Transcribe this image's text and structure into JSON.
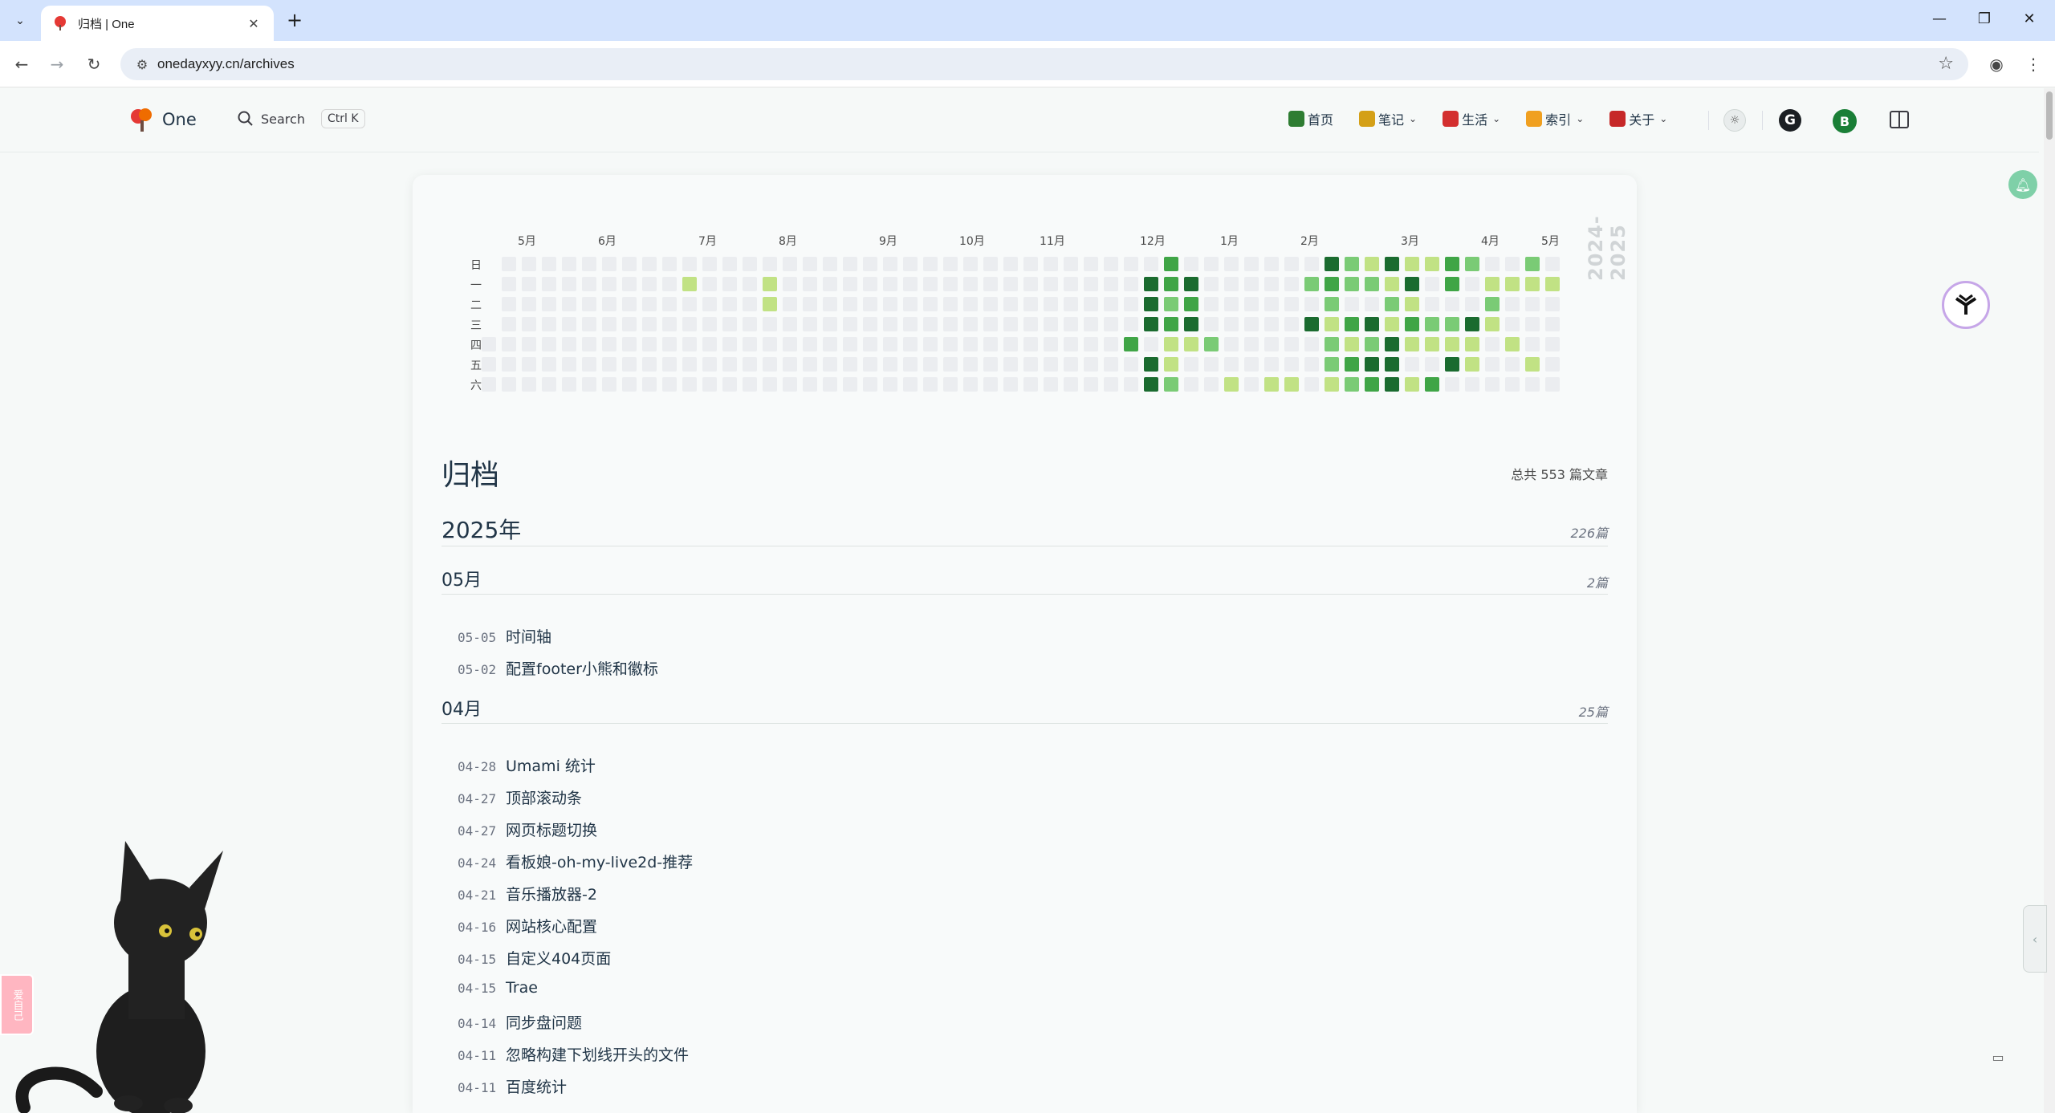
{
  "browser": {
    "tab_title": "归档 | One",
    "url": "onedayxyy.cn/archives",
    "new_tab_symbol": "+",
    "close_symbol": "✕"
  },
  "header": {
    "logo_text": "One",
    "search_label": "Search",
    "search_shortcut": "Ctrl K",
    "nav": [
      {
        "label": "首页",
        "color": "#2e7d32",
        "has_dropdown": false
      },
      {
        "label": "笔记",
        "color": "#d4a017",
        "has_dropdown": true
      },
      {
        "label": "生活",
        "color": "#d32f2f",
        "has_dropdown": true
      },
      {
        "label": "索引",
        "color": "#f0a020",
        "has_dropdown": true
      },
      {
        "label": "关于",
        "color": "#c62828",
        "has_dropdown": true
      }
    ],
    "github_glyph": "G",
    "avatar_letter": "B"
  },
  "heatmap": {
    "months": [
      "5月",
      "6月",
      "7月",
      "8月",
      "9月",
      "10月",
      "11月",
      "12月",
      "1月",
      "2月",
      "3月",
      "4月",
      "5月"
    ],
    "weekdays": [
      "日",
      "一",
      "二",
      "三",
      "四",
      "五",
      "六"
    ],
    "year_label": "2024-2025",
    "colors": [
      "#ebedf0",
      "#c1e284",
      "#7acb75",
      "#3fa546",
      "#1a6b2f"
    ],
    "weeks": 53,
    "active_cells": [
      [
        10,
        1,
        1
      ],
      [
        14,
        1,
        1
      ],
      [
        14,
        2,
        1
      ],
      [
        32,
        4,
        3
      ],
      [
        33,
        1,
        4
      ],
      [
        33,
        2,
        4
      ],
      [
        33,
        3,
        4
      ],
      [
        33,
        5,
        4
      ],
      [
        33,
        6,
        4
      ],
      [
        34,
        0,
        3
      ],
      [
        34,
        1,
        3
      ],
      [
        34,
        2,
        2
      ],
      [
        34,
        3,
        3
      ],
      [
        34,
        4,
        1
      ],
      [
        34,
        5,
        1
      ],
      [
        34,
        6,
        2
      ],
      [
        35,
        1,
        4
      ],
      [
        35,
        2,
        3
      ],
      [
        35,
        3,
        4
      ],
      [
        35,
        4,
        1
      ],
      [
        36,
        4,
        2
      ],
      [
        37,
        6,
        1
      ],
      [
        39,
        6,
        1
      ],
      [
        40,
        6,
        1
      ],
      [
        41,
        1,
        2
      ],
      [
        41,
        3,
        4
      ],
      [
        42,
        0,
        4
      ],
      [
        42,
        1,
        3
      ],
      [
        42,
        2,
        2
      ],
      [
        42,
        3,
        1
      ],
      [
        42,
        4,
        2
      ],
      [
        42,
        5,
        2
      ],
      [
        42,
        6,
        1
      ],
      [
        43,
        0,
        2
      ],
      [
        43,
        1,
        2
      ],
      [
        43,
        3,
        3
      ],
      [
        43,
        4,
        1
      ],
      [
        43,
        5,
        3
      ],
      [
        43,
        6,
        2
      ],
      [
        44,
        0,
        1
      ],
      [
        44,
        1,
        2
      ],
      [
        44,
        3,
        4
      ],
      [
        44,
        4,
        2
      ],
      [
        44,
        5,
        4
      ],
      [
        44,
        6,
        3
      ],
      [
        45,
        0,
        4
      ],
      [
        45,
        1,
        1
      ],
      [
        45,
        2,
        2
      ],
      [
        45,
        3,
        1
      ],
      [
        45,
        4,
        4
      ],
      [
        45,
        5,
        4
      ],
      [
        45,
        6,
        4
      ],
      [
        46,
        0,
        1
      ],
      [
        46,
        1,
        4
      ],
      [
        46,
        2,
        1
      ],
      [
        46,
        3,
        3
      ],
      [
        46,
        4,
        1
      ],
      [
        46,
        6,
        1
      ],
      [
        47,
        0,
        1
      ],
      [
        47,
        3,
        2
      ],
      [
        47,
        4,
        1
      ],
      [
        47,
        6,
        3
      ],
      [
        48,
        0,
        3
      ],
      [
        48,
        1,
        3
      ],
      [
        48,
        3,
        2
      ],
      [
        48,
        4,
        1
      ],
      [
        48,
        5,
        4
      ],
      [
        49,
        0,
        2
      ],
      [
        49,
        3,
        4
      ],
      [
        49,
        4,
        1
      ],
      [
        49,
        5,
        1
      ],
      [
        50,
        1,
        1
      ],
      [
        50,
        2,
        2
      ],
      [
        50,
        3,
        1
      ],
      [
        51,
        1,
        1
      ],
      [
        51,
        4,
        1
      ],
      [
        52,
        0,
        2
      ],
      [
        52,
        1,
        1
      ],
      [
        52,
        5,
        1
      ],
      [
        53,
        1,
        1
      ]
    ]
  },
  "archive": {
    "title": "归档",
    "total": "总共 553 篇文章",
    "year": "2025年",
    "year_count": "226篇",
    "months": [
      {
        "label": "05月",
        "count": "2篇",
        "posts": [
          {
            "date": "05-05",
            "title": "时间轴"
          },
          {
            "date": "05-02",
            "title": "配置footer小熊和徽标"
          }
        ]
      },
      {
        "label": "04月",
        "count": "25篇",
        "posts": [
          {
            "date": "04-28",
            "title": "Umami 统计"
          },
          {
            "date": "04-27",
            "title": "顶部滚动条"
          },
          {
            "date": "04-27",
            "title": "网页标题切换"
          },
          {
            "date": "04-24",
            "title": "看板娘-oh-my-live2d-推荐"
          },
          {
            "date": "04-21",
            "title": "音乐播放器-2"
          },
          {
            "date": "04-16",
            "title": "网站核心配置"
          },
          {
            "date": "04-15",
            "title": "自定义404页面"
          },
          {
            "date": "04-15",
            "title": "Trae"
          },
          {
            "date": "04-14",
            "title": "同步盘问题"
          },
          {
            "date": "04-11",
            "title": "忽略构建下划线开头的文件"
          },
          {
            "date": "04-11",
            "title": "百度统计"
          }
        ]
      }
    ]
  },
  "widgets": {
    "pink_badge_text": "爱自己"
  }
}
